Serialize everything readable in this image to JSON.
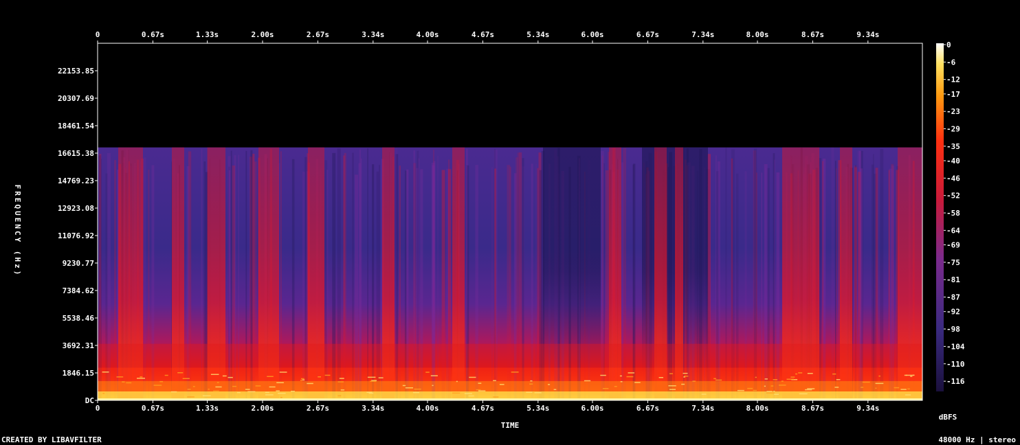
{
  "chart_data": {
    "type": "heatmap",
    "title": "",
    "xlabel": "TIME",
    "ylabel": "FREQUENCY (Hz)",
    "x_ticks": [
      "0",
      "0.67s",
      "1.33s",
      "2.00s",
      "2.67s",
      "3.34s",
      "4.00s",
      "4.67s",
      "5.34s",
      "6.00s",
      "6.67s",
      "7.34s",
      "8.00s",
      "8.67s",
      "9.34s"
    ],
    "x_tick_values": [
      0,
      0.67,
      1.33,
      2.0,
      2.67,
      3.34,
      4.0,
      4.67,
      5.34,
      6.0,
      6.67,
      7.34,
      8.0,
      8.67,
      9.34
    ],
    "xlim": [
      0,
      10.0
    ],
    "y_ticks": [
      "DC",
      "1846.15",
      "3692.31",
      "5538.46",
      "7384.62",
      "9230.77",
      "11076.92",
      "12923.08",
      "14769.23",
      "16615.38",
      "18461.54",
      "20307.69",
      "22153.85"
    ],
    "y_tick_values": [
      0,
      1846.15,
      3692.31,
      5538.46,
      7384.62,
      9230.77,
      11076.92,
      12923.08,
      14769.23,
      16615.38,
      18461.54,
      20307.69,
      22153.85
    ],
    "ylim": [
      0,
      24000
    ],
    "cutoff_hz": 17000,
    "colorbar": {
      "label": "dBFS",
      "ticks": [
        "0",
        "-6",
        "-12",
        "-17",
        "-23",
        "-29",
        "-35",
        "-40",
        "-46",
        "-52",
        "-58",
        "-64",
        "-69",
        "-75",
        "-81",
        "-87",
        "-92",
        "-98",
        "-104",
        "-110",
        "-116"
      ],
      "range": [
        -120,
        0
      ]
    },
    "bright_bands_s": [
      [
        0.25,
        0.55
      ],
      [
        0.9,
        1.05
      ],
      [
        1.33,
        1.55
      ],
      [
        1.95,
        2.2
      ],
      [
        2.55,
        2.75
      ],
      [
        3.45,
        3.6
      ],
      [
        4.3,
        4.45
      ],
      [
        6.2,
        6.35
      ],
      [
        6.75,
        6.9
      ],
      [
        7.0,
        7.1
      ],
      [
        8.3,
        8.75
      ],
      [
        9.0,
        9.15
      ],
      [
        9.7,
        10.0
      ]
    ],
    "quiet_regions_s": [
      [
        5.4,
        6.1
      ],
      [
        6.6,
        7.4
      ]
    ]
  },
  "footer": {
    "left": "CREATED BY LIBAVFILTER",
    "right": "48000 Hz | stereo"
  },
  "colors": {
    "background": "#000000",
    "frame": "#ffffff"
  }
}
